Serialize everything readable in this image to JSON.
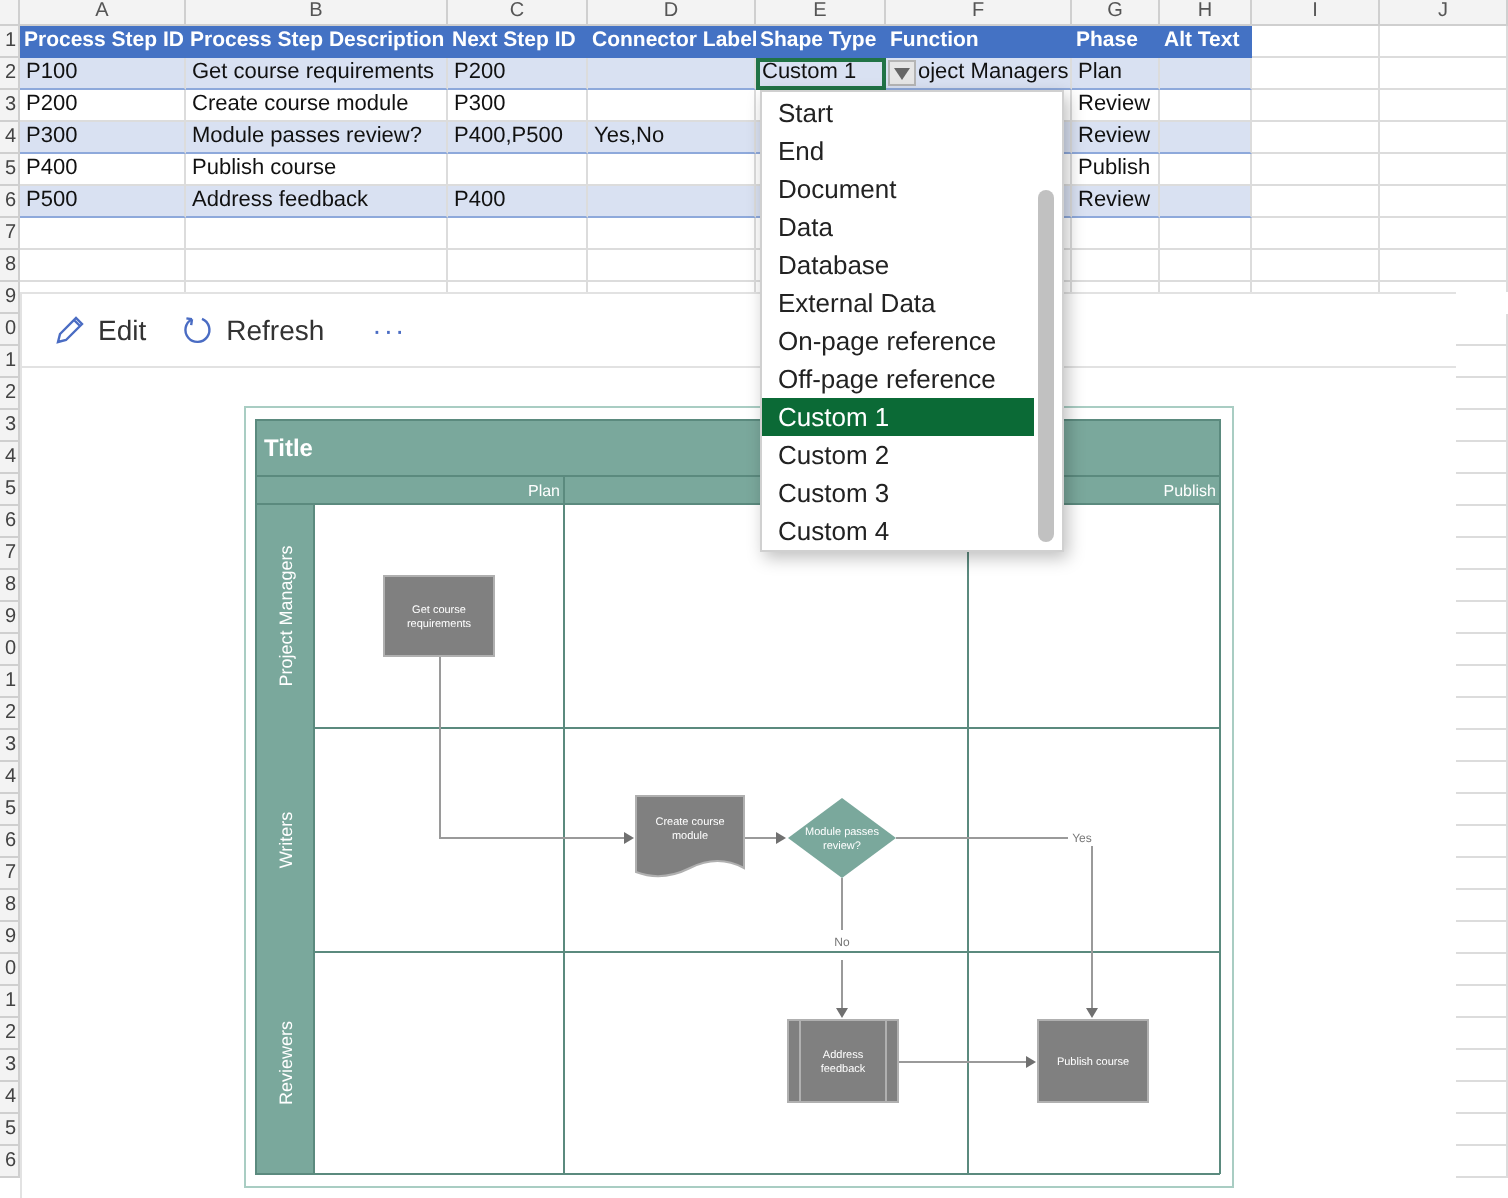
{
  "sheet": {
    "column_letters": [
      "A",
      "B",
      "C",
      "D",
      "E",
      "F",
      "G",
      "H",
      "I",
      "J"
    ],
    "row_numbers": [
      "1",
      "2",
      "3",
      "4",
      "5",
      "6",
      "7",
      "8",
      "9",
      "0",
      "1",
      "2",
      "3",
      "4",
      "5",
      "6",
      "7",
      "8",
      "9",
      "0",
      "1",
      "2",
      "3",
      "4",
      "5",
      "6",
      "7",
      "8",
      "9",
      "0",
      "1",
      "2",
      "3",
      "4",
      "5",
      "6"
    ],
    "headers": [
      "Process Step ID",
      "Process Step Description",
      "Next Step ID",
      "Connector Label",
      "Shape Type",
      "Function",
      "Phase",
      "Alt Text"
    ],
    "rows": [
      {
        "cells": [
          {
            "text": "P100",
            "selected": false
          },
          {
            "text": "Get course requirements",
            "selected": false
          },
          {
            "text": "P200",
            "selected": false
          },
          {
            "selected": false
          },
          {
            "text": "Custom 1",
            "selected": true
          },
          {
            "text": "oject Managers",
            "selected": false
          },
          {
            "text": "Plan",
            "selected": false
          },
          {
            "selected": false
          }
        ]
      },
      {
        "cells": [
          {
            "text": "P200",
            "selected": false
          },
          {
            "text": "Create course module",
            "selected": false
          },
          {
            "text": "P300",
            "selected": false
          },
          {
            "selected": false
          },
          {
            "selected": false
          },
          {
            "selected": false
          },
          {
            "text": "Review",
            "selected": false
          },
          {
            "selected": false
          }
        ]
      },
      {
        "cells": [
          {
            "text": "P300",
            "selected": false
          },
          {
            "text": "Module passes review?",
            "selected": false
          },
          {
            "text": "P400,P500",
            "selected": false
          },
          {
            "text": "Yes,No",
            "selected": false
          },
          {
            "selected": false
          },
          {
            "selected": false
          },
          {
            "text": "Review",
            "selected": false
          },
          {
            "selected": false
          }
        ]
      },
      {
        "cells": [
          {
            "text": "P400",
            "selected": false
          },
          {
            "text": "Publish course",
            "selected": false
          },
          {
            "selected": false
          },
          {
            "selected": false
          },
          {
            "selected": false
          },
          {
            "selected": false
          },
          {
            "text": "Publish",
            "selected": false
          },
          {
            "selected": false
          }
        ]
      },
      {
        "cells": [
          {
            "text": "P500",
            "selected": false
          },
          {
            "text": "Address feedback",
            "selected": false
          },
          {
            "text": "P400",
            "selected": false
          },
          {
            "selected": false
          },
          {
            "selected": false
          },
          {
            "selected": false
          },
          {
            "text": "Review",
            "selected": false
          },
          {
            "selected": false
          }
        ]
      }
    ]
  },
  "dropdown": {
    "options": [
      {
        "label": "Start",
        "selected": false
      },
      {
        "label": "End",
        "selected": false
      },
      {
        "label": "Document",
        "selected": false
      },
      {
        "label": "Data",
        "selected": false
      },
      {
        "label": "Database",
        "selected": false
      },
      {
        "label": "External Data",
        "selected": false
      },
      {
        "label": "On-page reference",
        "selected": false
      },
      {
        "label": "Off-page reference",
        "selected": false
      },
      {
        "label": "Custom 1",
        "selected": true
      },
      {
        "label": "Custom 2",
        "selected": false
      },
      {
        "label": "Custom 3",
        "selected": false
      },
      {
        "label": "Custom 4",
        "selected": false
      }
    ]
  },
  "panel": {
    "toolbar": [
      {
        "kind": "edit",
        "label": "Edit"
      },
      {
        "kind": "refresh",
        "label": "Refresh"
      },
      {
        "kind": "more",
        "label": "···"
      }
    ]
  },
  "diagram": {
    "title": "Title",
    "first_phase": "Plan",
    "last_phase": "Publish",
    "lanes": [
      "Project Managers",
      "Writers",
      "Reviewers"
    ],
    "shapes": [
      {
        "kind": "process",
        "lines": [
          "Get course",
          "requirements"
        ]
      },
      {
        "kind": "document",
        "lines": [
          "Create course",
          "module"
        ]
      },
      {
        "kind": "decision",
        "lines": [
          "Module passes",
          "review?"
        ]
      },
      {
        "kind": "subprocess",
        "lines": [
          "Address",
          "feedback"
        ]
      },
      {
        "kind": "process",
        "lines": [
          "Publish course"
        ]
      }
    ],
    "connector_labels": [
      "Yes",
      "No"
    ]
  }
}
